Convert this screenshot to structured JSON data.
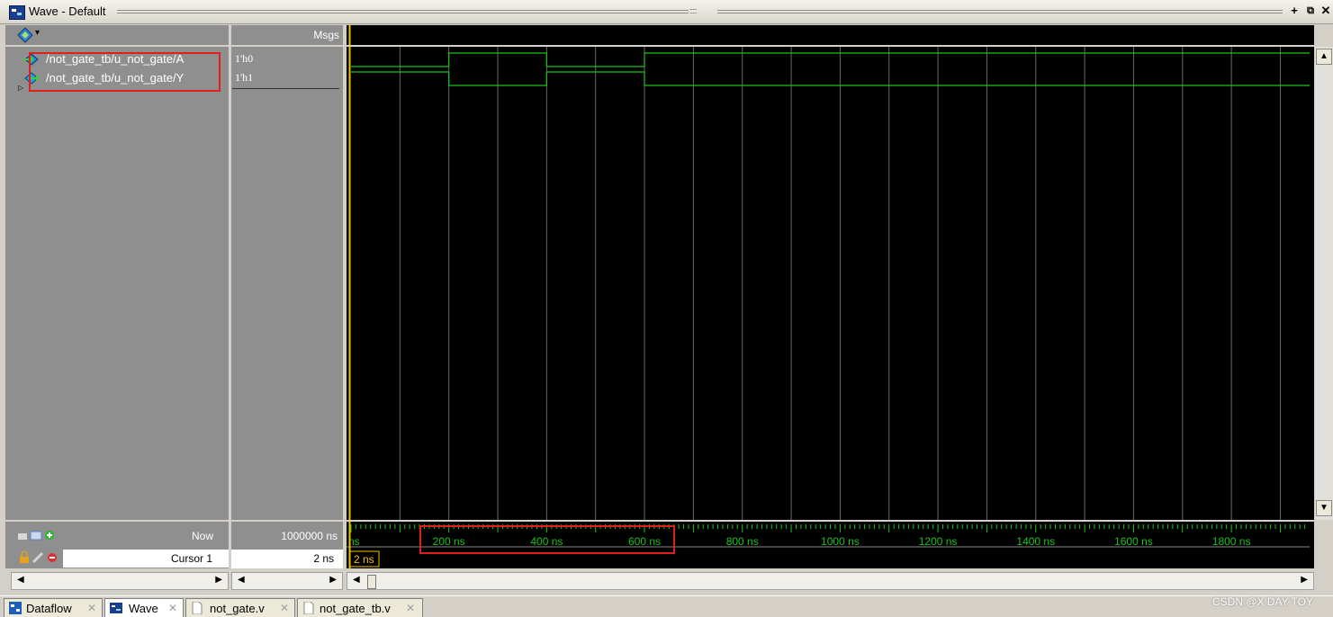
{
  "window": {
    "title": "Wave - Default",
    "grip": ":::::"
  },
  "header": {
    "msgs_label": "Msgs"
  },
  "signals": [
    {
      "name": "/not_gate_tb/u_not_gate/A",
      "value": "1'h0"
    },
    {
      "name": "/not_gate_tb/u_not_gate/Y",
      "value": "1'h1"
    }
  ],
  "waveform": {
    "time_unit": "ns",
    "range_start": 0,
    "range_end": 1970,
    "A_transitions": [
      [
        0,
        0
      ],
      [
        200,
        1
      ],
      [
        400,
        0
      ],
      [
        600,
        1
      ]
    ],
    "Y_transitions": [
      [
        0,
        1
      ],
      [
        200,
        0
      ],
      [
        400,
        1
      ],
      [
        600,
        0
      ]
    ],
    "grid_step": 100,
    "trace_color": "#19c419",
    "cursor_color": "#f2c200"
  },
  "status": {
    "now_label": "Now",
    "now_value": "1000000 ns",
    "cursor_label": "Cursor 1",
    "cursor_value": "2 ns",
    "cursor_marker": "2 ns"
  },
  "ruler": {
    "first_label": "ns",
    "labels": [
      "200 ns",
      "400 ns",
      "600 ns",
      "800 ns",
      "1000 ns",
      "1200 ns",
      "1400 ns",
      "1600 ns",
      "1800 ns"
    ],
    "label_color": "#19c419"
  },
  "tabs": [
    {
      "label": "Dataflow",
      "icon": "dataflow-icon"
    },
    {
      "label": "Wave",
      "icon": "wave-icon",
      "active": true
    },
    {
      "label": "not_gate.v",
      "icon": "file-icon"
    },
    {
      "label": "not_gate_tb.v",
      "icon": "file-icon"
    }
  ],
  "watermark": "CSDN @X DAY TOY",
  "highlight_color": "#e0201b"
}
